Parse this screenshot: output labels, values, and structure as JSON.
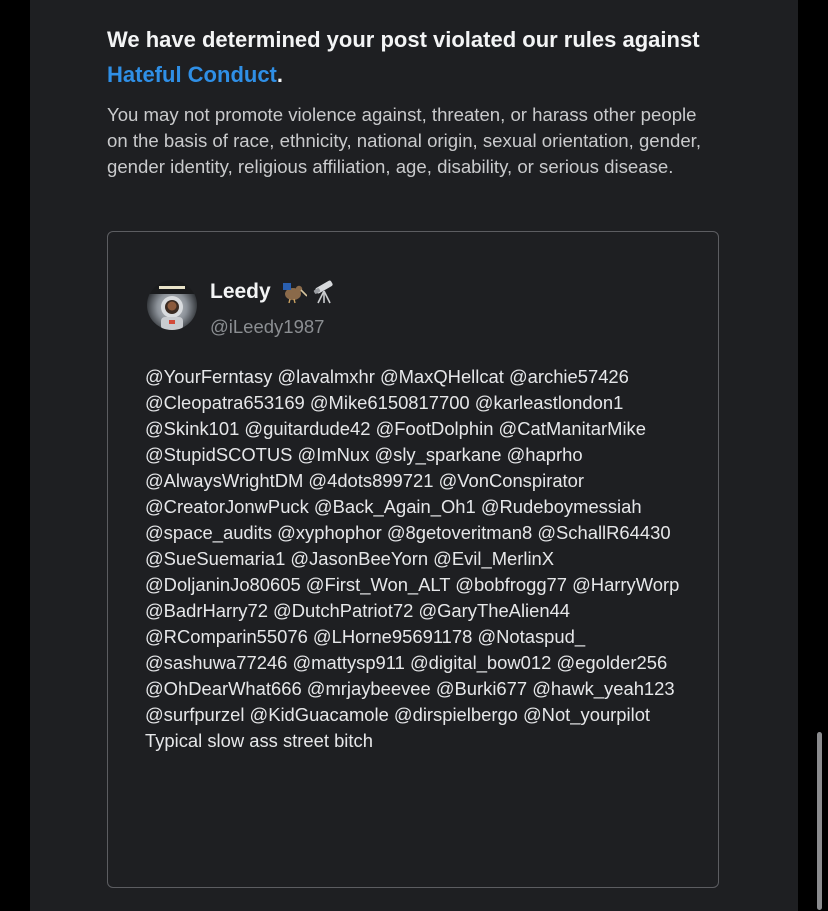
{
  "notice": {
    "title_prefix": "We have determined your post violated our rules against ",
    "rule_link": "Hateful Conduct",
    "title_suffix": ".",
    "description": "You may not promote violence against, threaten, or harass other people on the basis of race, ethnicity, national origin, sexual orientation, gender, gender identity, religious affiliation, age, disability, or serious disease."
  },
  "tweet": {
    "display_name": "Leedy",
    "name_emojis": [
      "kiwi-bird-emoji",
      "telescope-emoji"
    ],
    "handle": "@iLeedy1987",
    "text": "@YourFerntasy @lavalmxhr @MaxQHellcat @archie57426 @Cleopatra653169 @Mike6150817700 @karleastlondon1 @Skink101 @guitardude42 @FootDolphin @CatManitarMike @StupidSCOTUS @ImNux @sly_sparkane @haprho @AlwaysWrightDM @4dots899721 @VonConspirator @CreatorJonwPuck @Back_Again_Oh1 @Rudeboymessiah @space_audits @xyphophor @8getoveritman8 @SchallR64430 @SueSuemaria1 @JasonBeeYorn @Evil_MerlinX @DoljaninJo80605 @First_Won_ALT @bobfrogg77 @HarryWorp @BadrHarry72 @DutchPatriot72 @GaryTheAlien44 @RComparin55076 @LHorne95691178 @Notaspud_ @sashuwa77246 @mattysp911 @digital_bow012 @egolder256 @OhDearWhat666 @mrjaybeevee @Burki677 @hawk_yeah123 @surfpurzel @KidGuacamole @dirspielbergo @Not_yourpilot Typical slow ass street bitch"
  },
  "colors": {
    "background": "#000000",
    "panel": "#1e1f22",
    "link": "#2f8fe6",
    "card_border": "#5c5d61"
  }
}
